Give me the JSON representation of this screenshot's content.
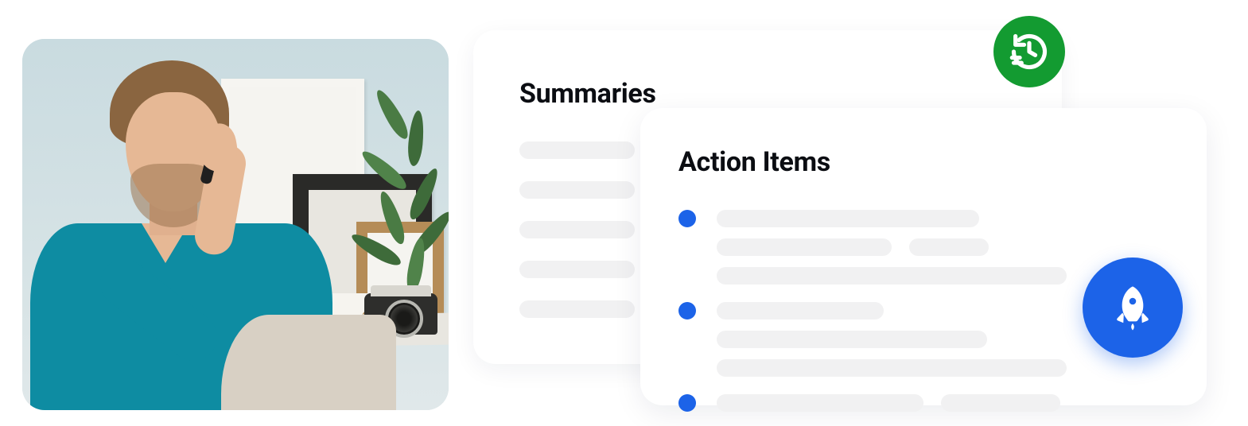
{
  "photo": {
    "alt": "Man on phone at desk with picture frames, plant, camera and coffee cup"
  },
  "summaries": {
    "title": "Summaries"
  },
  "action_items": {
    "title": "Action Items"
  },
  "badges": {
    "history_icon_name": "history-icon",
    "rocket_icon_name": "rocket-icon"
  },
  "colors": {
    "accent_blue": "#1c63e8",
    "badge_green": "#139b31",
    "skeleton": "#f1f1f2"
  }
}
